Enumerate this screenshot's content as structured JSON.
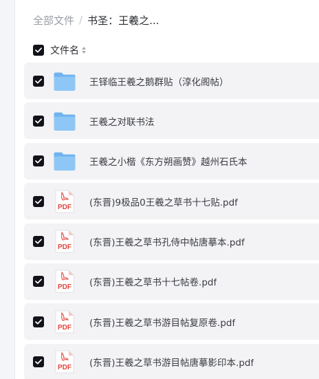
{
  "breadcrumb": {
    "root": "全部文件",
    "separator": "/",
    "current": "书圣：王羲之..."
  },
  "header": {
    "column_name": "文件名",
    "select_all_checked": true
  },
  "files": [
    {
      "name": "王铎临王羲之鹅群贴（淳化阁帖）",
      "type": "folder",
      "icon": "folder-icon",
      "checked": true
    },
    {
      "name": "王羲之对联书法",
      "type": "folder",
      "icon": "folder-icon",
      "checked": true
    },
    {
      "name": "王羲之小楷《东方朔画赞》越州石氏本",
      "type": "folder",
      "icon": "folder-icon",
      "checked": true
    },
    {
      "name": "(东晋)9极品0王羲之草书十七贴.pdf",
      "type": "pdf",
      "icon": "pdf-file-icon",
      "checked": true
    },
    {
      "name": "(东晋)王羲之草书孔侍中帖唐摹本.pdf",
      "type": "pdf",
      "icon": "pdf-file-icon",
      "checked": true
    },
    {
      "name": "(东晋)王羲之草书十七帖卷.pdf",
      "type": "pdf",
      "icon": "pdf-file-icon",
      "checked": true
    },
    {
      "name": "(东晋)王羲之草书游目帖复原卷.pdf",
      "type": "pdf",
      "icon": "pdf-file-icon",
      "checked": true
    },
    {
      "name": "(东晋)王羲之草书游目帖唐摹影印本.pdf",
      "type": "pdf",
      "icon": "pdf-file-icon",
      "checked": true
    }
  ],
  "pdf_badge": "PDF",
  "colors": {
    "folder": "#8ec7f6",
    "pdf_accent": "#e2453c",
    "checkbox": "#121318",
    "row_bg": "#f3f3f5"
  }
}
